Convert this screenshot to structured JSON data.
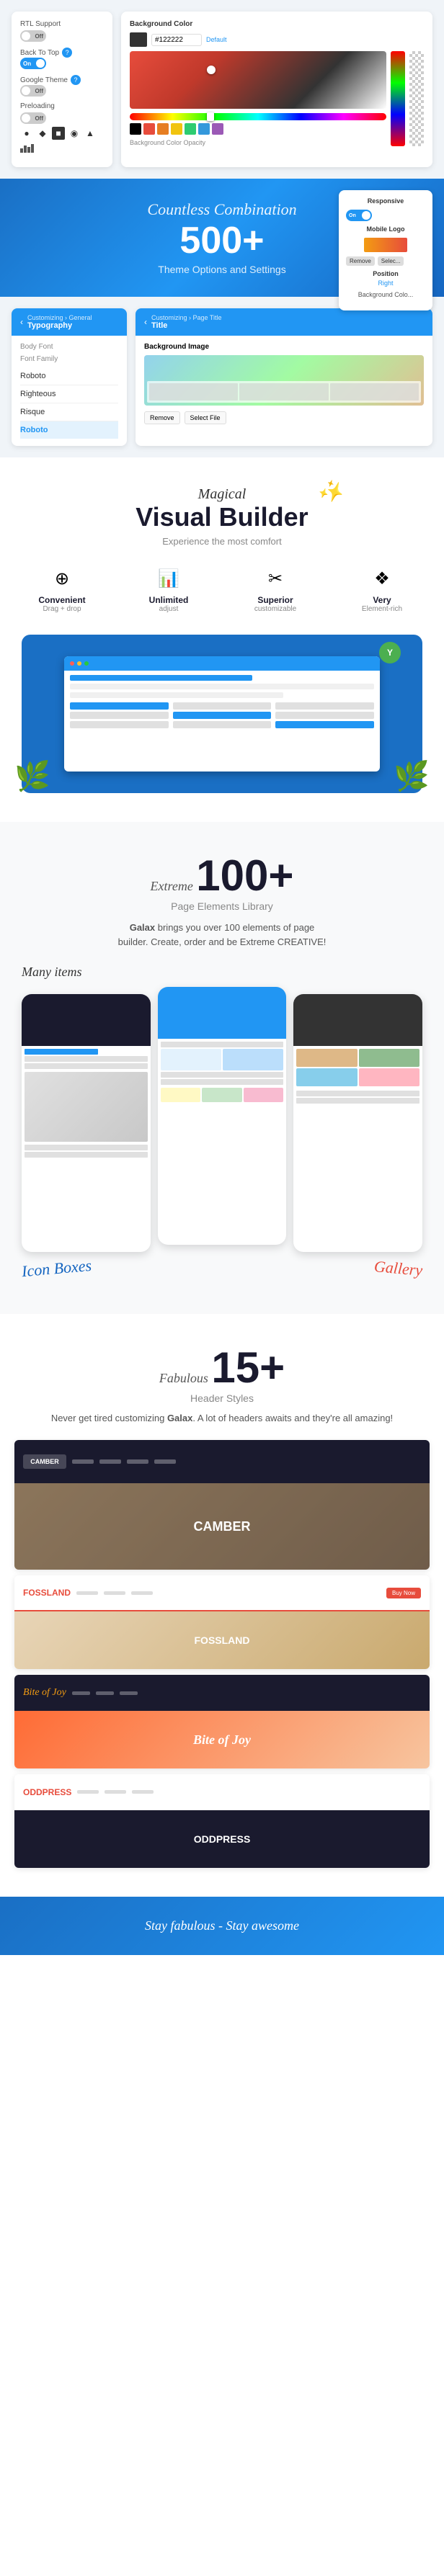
{
  "theme_options": {
    "title": "Theme Options and Settings",
    "rtl_label": "RTL Support",
    "rtl_state": "Off",
    "back_to_top_label": "Back To Top",
    "back_to_top_state": "On",
    "google_theme_label": "Google Theme",
    "google_theme_state": "Off",
    "preloading_label": "Preloading",
    "preloading_state": "Off",
    "bg_color_label": "Background Color",
    "bg_color_value": "#122222",
    "bg_color_default": "Default",
    "bg_opacity_label": "Background Color Opacity"
  },
  "hero": {
    "script_text": "Countless Combination",
    "big_number": "500+",
    "subtitle": "Theme Options and Settings",
    "responsive_label": "Responsive",
    "mobile_logo_label": "Mobile Logo",
    "remove_btn": "Remove",
    "select_btn": "Selec...",
    "position_label": "Position",
    "position_value": "Right",
    "bg_color_label": "Background Colo..."
  },
  "typography": {
    "breadcrumb": "Customizing › General",
    "section": "Typography",
    "body_font_label": "Body Font",
    "font_family_label": "Font Family",
    "font1": "Roboto",
    "font2": "Righteous",
    "font3": "Risque",
    "font4": "Roboto",
    "page_title_breadcrumb": "Customizing › Page Title",
    "page_title_section": "Title",
    "bg_image_label": "Background Image",
    "remove_btn": "Remove",
    "select_file_btn": "Select File"
  },
  "visual_builder": {
    "script_text": "Magical",
    "title": "Visual Builder",
    "subtitle": "Experience the most comfort",
    "features": [
      {
        "icon": "⊕",
        "title": "Convenient",
        "sub": "Drag + drop"
      },
      {
        "icon": "⬛",
        "title": "Unlimited",
        "sub": "adjust"
      },
      {
        "icon": "✂",
        "title": "Superior",
        "sub": "customizable"
      },
      {
        "icon": "❖",
        "title": "Very",
        "sub": "Element-rich"
      }
    ]
  },
  "page_elements": {
    "script_text": "Extreme",
    "number": "100+",
    "title": "Page Elements Library",
    "description": "Galax brings you over 100 elements of page builder. Create, order and be Extreme CREATIVE!",
    "brand": "Galax",
    "labels": {
      "many_items": "Many items",
      "icon_boxes": "Icon Boxes",
      "gallery": "Gallery"
    }
  },
  "header_styles": {
    "script_text": "Fabulous",
    "number": "15+",
    "title": "Header Styles",
    "description": "Never get tired customizing Galax. A lot of headers awaits and they're all amazing!",
    "brand": "Galax",
    "headers": [
      {
        "name": "camber",
        "type": "dark",
        "logo_text": "CAMBER"
      },
      {
        "name": "fossland",
        "type": "colored",
        "logo_text": "FOSSLAND"
      },
      {
        "name": "bite-of-joy",
        "type": "script",
        "logo_text": "Bite of Joy"
      },
      {
        "name": "oddpress",
        "type": "white",
        "logo_text": "ODDPRESS"
      }
    ]
  },
  "footer": {
    "tagline_part1": "Stay fabulous",
    "dash": " - ",
    "tagline_part2": "Stay awesome"
  }
}
